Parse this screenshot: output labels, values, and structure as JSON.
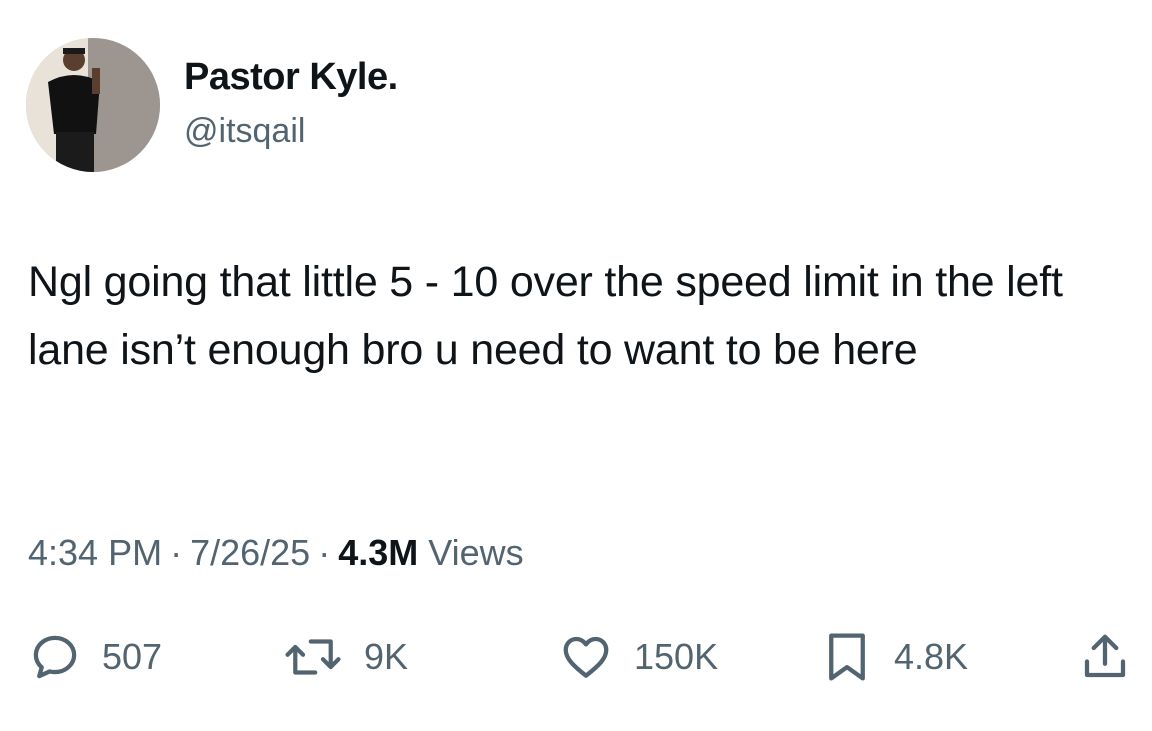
{
  "author": {
    "display_name": "Pastor Kyle.",
    "handle": "@itsqail"
  },
  "tweet": {
    "text": "Ngl going that little 5 - 10 over the speed limit in the left lane isn’t enough bro u need to want to be here"
  },
  "meta": {
    "time": "4:34 PM",
    "separator": "·",
    "date": "7/26/25",
    "views_count": "4.3M",
    "views_label": "Views"
  },
  "actions": {
    "replies": "507",
    "reposts": "9K",
    "likes": "150K",
    "bookmarks": "4.8K"
  },
  "icons": {
    "reply": "reply-icon",
    "repost": "repost-icon",
    "like": "heart-icon",
    "bookmark": "bookmark-icon",
    "share": "share-icon"
  },
  "colors": {
    "text_primary": "#0f1419",
    "text_secondary": "#536471",
    "background": "#ffffff"
  }
}
